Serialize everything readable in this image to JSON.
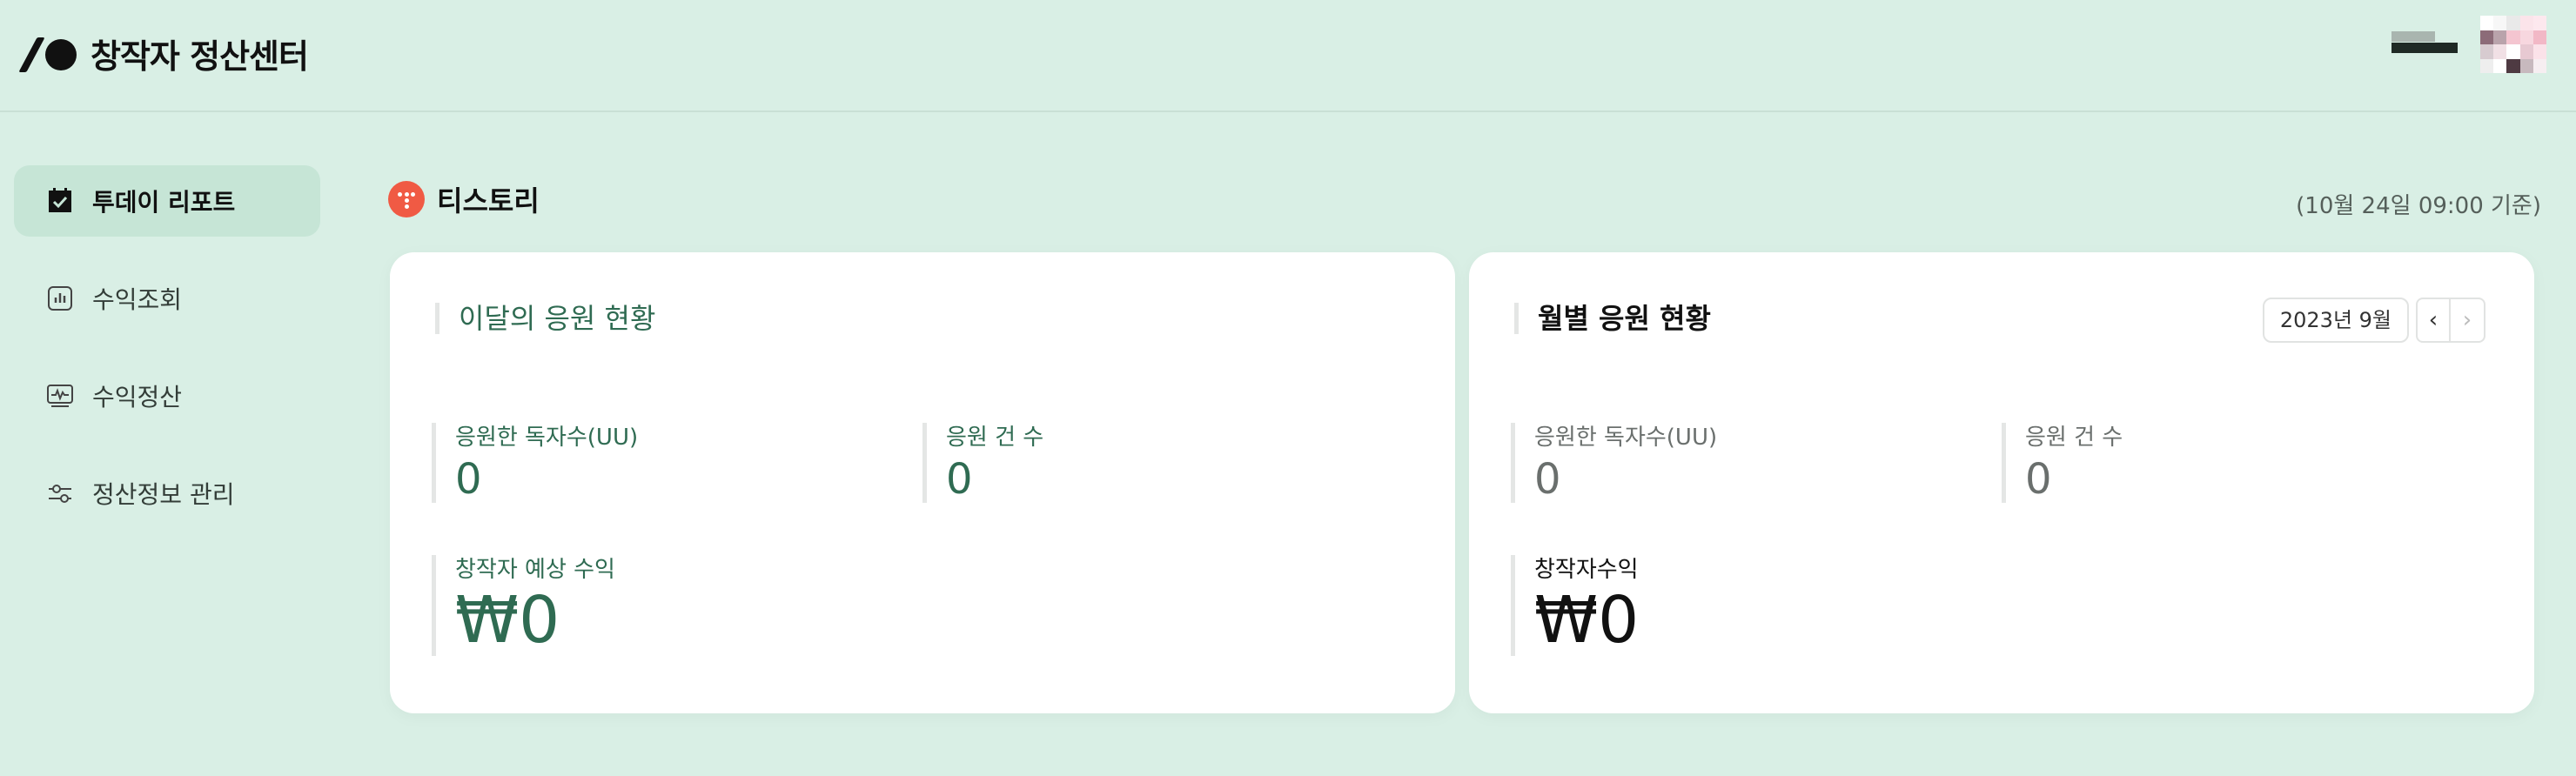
{
  "header": {
    "title": "창작자 정산센터",
    "logo_icon": "slash-dot-logo",
    "avatar_colors": [
      "#ffffff",
      "#f7f7f7",
      "#e9e9e9",
      "#fbe4ea",
      "#fde8ee",
      "#8c6b78",
      "#b9a3ab",
      "#f4c5d0",
      "#f7d7df",
      "#f2b8c6",
      "#d7cbd0",
      "#f1e0e5",
      "#ffffff",
      "#e7c9d2",
      "#fbe2e9",
      "#eeeeee",
      "#ffffff",
      "#4e3a42",
      "#c7b9be",
      "#f6eef1"
    ]
  },
  "sidebar": {
    "items": [
      {
        "label": "투데이 리포트",
        "icon": "calendar-check-icon",
        "active": true
      },
      {
        "label": "수익조회",
        "icon": "bar-chart-icon",
        "active": false
      },
      {
        "label": "수익정산",
        "icon": "monitor-pulse-icon",
        "active": false
      },
      {
        "label": "정산정보 관리",
        "icon": "sliders-icon",
        "active": false
      }
    ]
  },
  "section": {
    "title": "티스토리",
    "icon": "tistory-icon",
    "timestamp": "(10월 24일 09:00 기준)"
  },
  "card_this_month": {
    "title": "이달의 응원 현황",
    "readers_label": "응원한 독자수(UU)",
    "readers_value": "0",
    "count_label": "응원 건 수",
    "count_value": "0",
    "revenue_label": "창작자 예상 수익",
    "revenue_value": "₩0"
  },
  "card_monthly": {
    "title": "월별 응원 현황",
    "month_selector": "2023년 9월",
    "prev_icon": "chevron-left-icon",
    "next_icon": "chevron-right-icon",
    "prev_glyph": "‹",
    "next_glyph": "›",
    "readers_label": "응원한 독자수(UU)",
    "readers_value": "0",
    "count_label": "응원 건 수",
    "count_value": "0",
    "revenue_label": "창작자수익",
    "revenue_value": "₩0"
  },
  "colors": {
    "background": "#d9efe5",
    "accent_green": "#2f6b52",
    "tistory_red": "#f05a44",
    "active_nav": "#c6e5d6"
  }
}
